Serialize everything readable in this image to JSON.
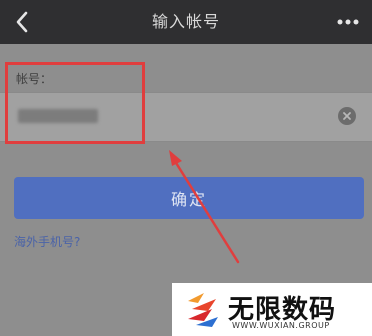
{
  "header": {
    "title": "输入帐号",
    "back_icon": "chevron-left-icon",
    "more_icon": "more-dots-icon"
  },
  "account": {
    "label": "帐号：",
    "value_masked": true,
    "clear_icon": "clear-icon"
  },
  "actions": {
    "confirm_label": "确定",
    "overseas_link": "海外手机号?"
  },
  "annotation": {
    "highlight_color": "#e03e3e"
  },
  "watermark": {
    "name": "无限数码",
    "url": "WWW.WUXIAN.GROUP"
  },
  "colors": {
    "topbar": "#2f2f31",
    "background": "#8e8e8e",
    "button": "#506fc0",
    "link": "#4a63a8"
  }
}
